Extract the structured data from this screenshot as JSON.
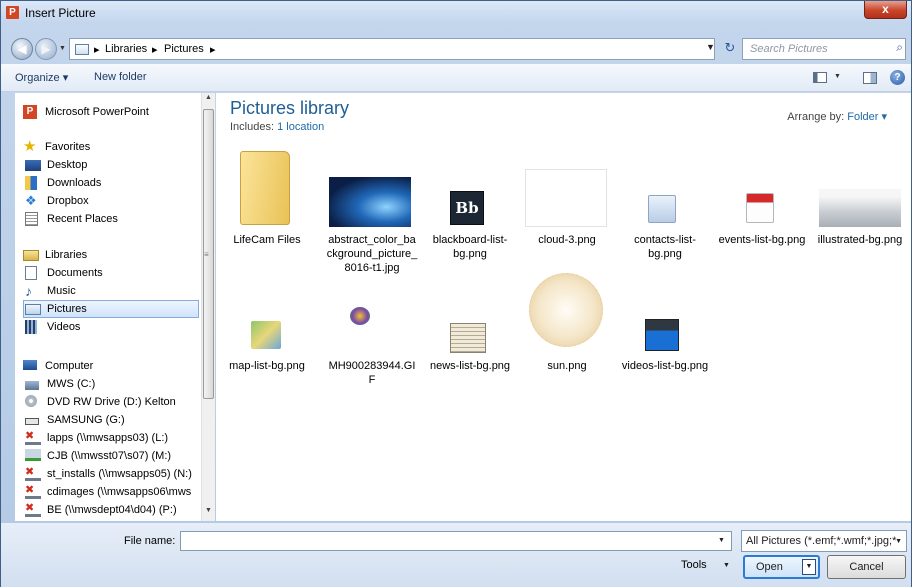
{
  "window": {
    "title": "Insert Picture",
    "app_icon": "P",
    "close_label": "x"
  },
  "address": {
    "crumbs": [
      "Libraries",
      "Pictures"
    ],
    "search_placeholder": "Search Pictures"
  },
  "toolbar": {
    "organize": "Organize",
    "new_folder": "New folder"
  },
  "nav": {
    "app": "Microsoft PowerPoint",
    "favorites": {
      "header": "Favorites",
      "items": [
        "Desktop",
        "Downloads",
        "Dropbox",
        "Recent Places"
      ]
    },
    "libraries": {
      "header": "Libraries",
      "items": [
        "Documents",
        "Music",
        "Pictures",
        "Videos"
      ],
      "selected": "Pictures"
    },
    "computer": {
      "header": "Computer",
      "items": [
        "MWS (C:)",
        "DVD RW Drive (D:) Kelton",
        "SAMSUNG (G:)",
        "lapps (\\\\mwsapps03) (L:)",
        "CJB (\\\\mwsst07\\s07) (M:)",
        "st_installs (\\\\mwsapps05) (N:)",
        "cdimages (\\\\mwsapps06\\mws",
        "BE (\\\\mwsdept04\\d04) (P:)"
      ]
    }
  },
  "library": {
    "title": "Pictures library",
    "includes_label": "Includes:",
    "includes_link": "1 location",
    "arrange_label": "Arrange by:",
    "arrange_value": "Folder"
  },
  "files": [
    {
      "name": "LifeCam Files",
      "icon": "folder-icon"
    },
    {
      "name": "abstract_color_background_picture_8016-t1.jpg",
      "icon": "abstract-image"
    },
    {
      "name": "blackboard-list-bg.png",
      "icon": "blackboard-logo"
    },
    {
      "name": "cloud-3.png",
      "icon": "blank-image"
    },
    {
      "name": "contacts-list-bg.png",
      "icon": "contact-card-icon"
    },
    {
      "name": "events-list-bg.png",
      "icon": "calendar-icon"
    },
    {
      "name": "illustrated-bg.png",
      "icon": "skyline-image"
    },
    {
      "name": "map-list-bg.png",
      "icon": "map-pin-icon"
    },
    {
      "name": "MH900283944.GIF",
      "icon": "clipart-image"
    },
    {
      "name": "news-list-bg.png",
      "icon": "newspaper-icon"
    },
    {
      "name": "sun.png",
      "icon": "sun-disc-image"
    },
    {
      "name": "videos-list-bg.png",
      "icon": "clapperboard-icon"
    }
  ],
  "bottom": {
    "file_name_label": "File name:",
    "file_name_value": "",
    "filter": "All Pictures (*.emf;*.wmf;*.jpg;*",
    "tools": "Tools",
    "open": "Open",
    "cancel": "Cancel"
  }
}
